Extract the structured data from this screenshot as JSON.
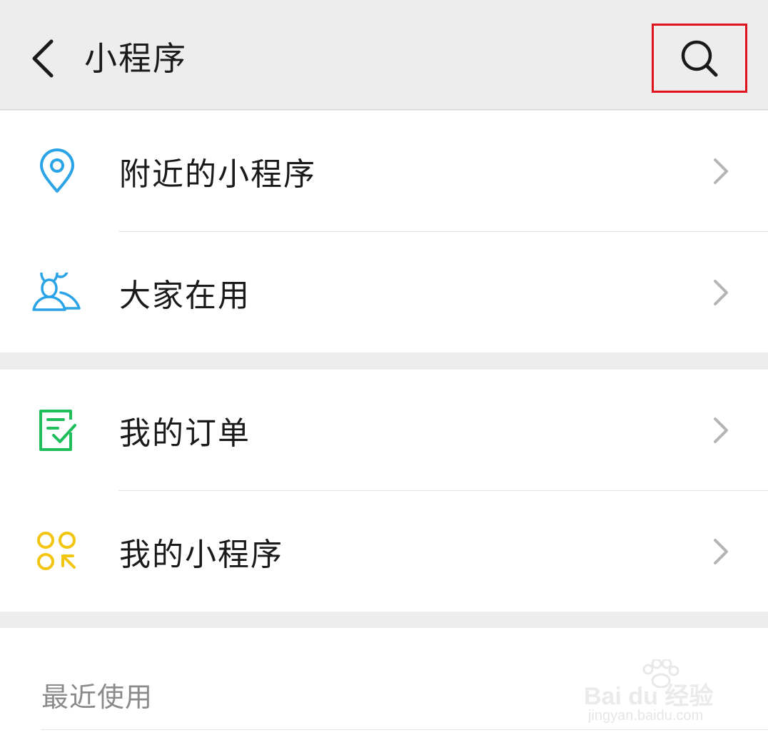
{
  "header": {
    "title": "小程序",
    "back_icon": "chevron-left-icon",
    "search_icon": "search-icon",
    "search_highlight_color": "#e1111b"
  },
  "groups": [
    {
      "items": [
        {
          "label": "附近的小程序",
          "icon": "location-pin-icon",
          "icon_color": "#2aa4e6"
        },
        {
          "label": "大家在用",
          "icon": "people-icon",
          "icon_color": "#2aa4e6"
        }
      ]
    },
    {
      "items": [
        {
          "label": "我的订单",
          "icon": "order-list-icon",
          "icon_color": "#1ebf5a"
        },
        {
          "label": "我的小程序",
          "icon": "my-miniprogram-icon",
          "icon_color": "#f2c511"
        }
      ]
    }
  ],
  "recent": {
    "title": "最近使用"
  },
  "watermark": {
    "brand": "Bai du 经验",
    "url": "jingyan.baidu.com"
  }
}
